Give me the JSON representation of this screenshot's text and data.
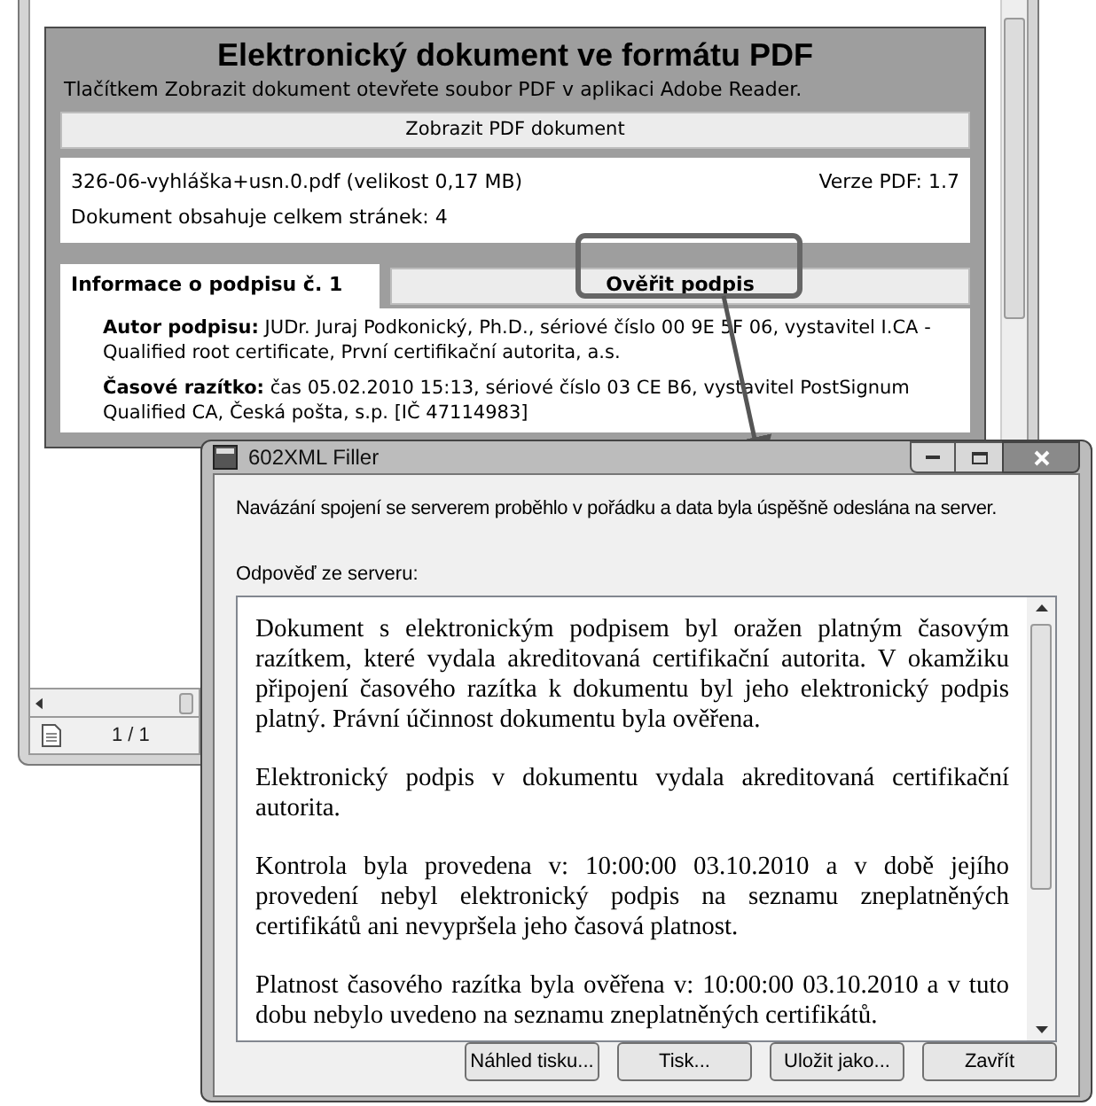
{
  "background_window": {
    "panel": {
      "title": "Elektronický dokument ve formátu PDF",
      "subtitle": "Tlačítkem Zobrazit dokument otevřete soubor PDF v aplikaci Adobe Reader.",
      "show_button": "Zobrazit PDF dokument",
      "file_name": "326-06-vyhláška+usn.0.pdf (velikost 0,17 MB)",
      "pdf_version": "Verze PDF: 1.7",
      "page_count": "Dokument obsahuje celkem stránek: 4",
      "tab": "Informace o podpisu č. 1",
      "verify_button": "Ověřit podpis",
      "details": [
        {
          "label": "Autor podpisu:",
          "text": "JUDr. Juraj Podkonický, Ph.D., sériové číslo 00 9E 5F 06, vystavitel I.CA - Qualified root certificate, První certifikační autorita, a.s."
        },
        {
          "label": "Časové razítko:",
          "text": "čas 05.02.2010 15:13, sériové číslo 03 CE B6, vystavitel PostSignum Qualified CA, Česká pošta, s.p. [IČ 47114983]"
        }
      ]
    },
    "status_bar": {
      "page": "1 / 1"
    }
  },
  "dialog": {
    "title": "602XML Filler",
    "message": "Navázání spojení se serverem proběhlo v pořádku a data byla úspěšně odeslána na server.",
    "response_label": "Odpověď ze serveru:",
    "response_paragraphs": [
      "Dokument s elektronickým podpisem byl oražen platným časovým razítkem, které vydala akreditovaná certifikační autorita. V okamžiku připojení časového razítka k dokumentu byl jeho elektronický podpis platný. Právní účinnost dokumentu byla ověřena.",
      "Elektronický podpis v dokumentu vydala akreditovaná certifikační autorita.",
      "Kontrola byla provedena v: 10:00:00 03.10.2010 a v době jejího provedení nebyl elektronický podpis na seznamu zneplatněných certifikátů ani nevypršela jeho časová platnost.",
      "Platnost časového razítka byla ověřena v: 10:00:00 03.10.2010 a v tuto dobu nebylo uvedeno na seznamu zneplatněných certifikátů."
    ],
    "buttons": [
      "Náhled tisku...",
      "Tisk...",
      "Uložit jako...",
      "Zavřít"
    ]
  }
}
